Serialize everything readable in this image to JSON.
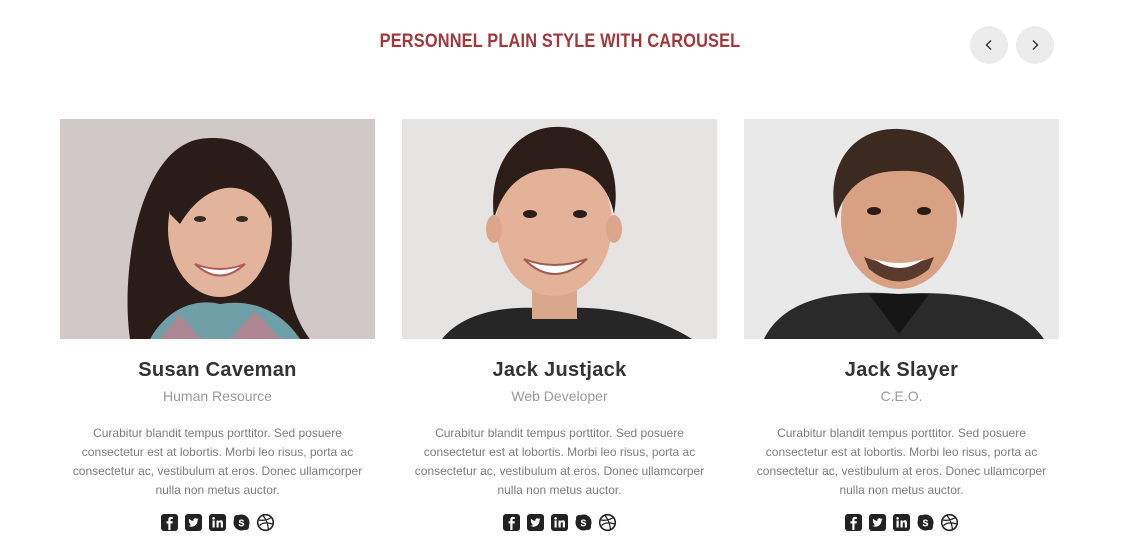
{
  "section": {
    "title": "PERSONNEL PLAIN STYLE WITH CAROUSEL"
  },
  "nav": {
    "prev_icon": "chevron-left-icon",
    "next_icon": "chevron-right-icon"
  },
  "accent_color": "#a1383b",
  "members": [
    {
      "name": "Susan Caveman",
      "role": "Human Resource",
      "bio": "Curabitur blandit tempus porttitor. Sed posuere consectetur est at lobortis. Morbi leo risus, porta ac consectetur ac, vestibulum at eros. Donec ullamcorper nulla non metus auctor.",
      "social": [
        "facebook-icon",
        "twitter-icon",
        "linkedin-icon",
        "skype-icon",
        "dribbble-icon"
      ]
    },
    {
      "name": "Jack Justjack",
      "role": "Web Developer",
      "bio": "Curabitur blandit tempus porttitor. Sed posuere consectetur est at lobortis. Morbi leo risus, porta ac consectetur ac, vestibulum at eros. Donec ullamcorper nulla non metus auctor.",
      "social": [
        "facebook-icon",
        "twitter-icon",
        "linkedin-icon",
        "skype-icon",
        "dribbble-icon"
      ]
    },
    {
      "name": "Jack Slayer",
      "role": "C.E.O.",
      "bio": "Curabitur blandit tempus porttitor. Sed posuere consectetur est at lobortis. Morbi leo risus, porta ac consectetur ac, vestibulum at eros. Donec ullamcorper nulla non metus auctor.",
      "social": [
        "facebook-icon",
        "twitter-icon",
        "linkedin-icon",
        "skype-icon",
        "dribbble-icon"
      ]
    }
  ]
}
